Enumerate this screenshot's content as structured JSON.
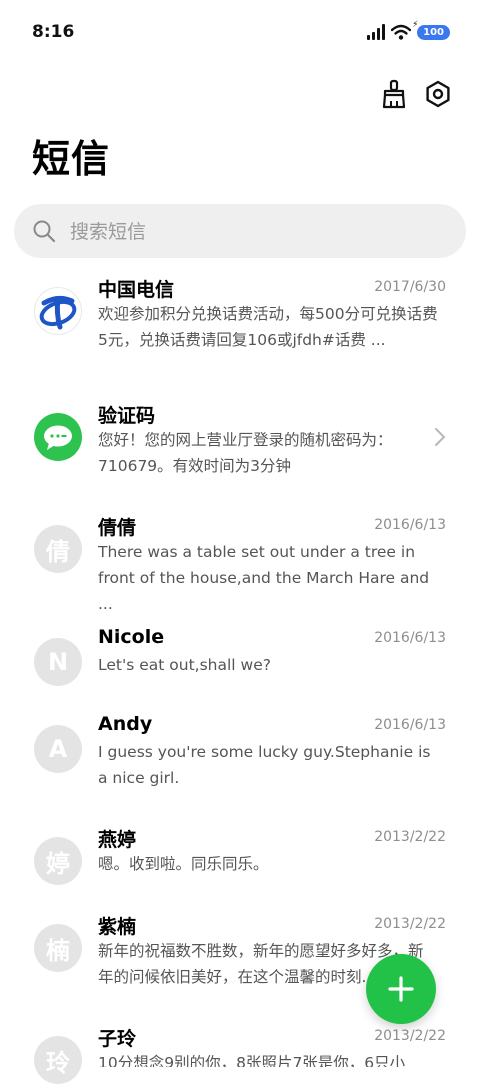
{
  "status_bar": {
    "time": "8:16",
    "battery": "100",
    "battery_charging_glyph": "⚡"
  },
  "toolbar": {
    "clean_icon": "broom-icon",
    "settings_icon": "settings-hexagon-icon"
  },
  "page": {
    "title": "短信"
  },
  "search": {
    "placeholder": "搜索短信",
    "value": ""
  },
  "messages": [
    {
      "avatar": "",
      "avatar_icon": "china-telecom-logo",
      "name": "中国电信",
      "date": "2017/6/30",
      "preview": "欢迎参加积分兑换话费活动，每500分可兑换话费5元，兑换话费请回复106或jfdh#话费 ..."
    },
    {
      "avatar": "",
      "avatar_icon": "chat-bubble-icon",
      "name": "验证码",
      "date": "",
      "preview": "您好！您的网上营业厅登录的随机密码为：710679。有效时间为3分钟"
    },
    {
      "avatar": "倩",
      "name": "倩倩",
      "date": "2016/6/13",
      "preview": "There was a table set out under a tree in front of the house,and the March Hare and ..."
    },
    {
      "avatar": "N",
      "name": "Nicole",
      "date": "2016/6/13",
      "preview": "Let's eat out,shall we?"
    },
    {
      "avatar": "A",
      "name": "Andy",
      "date": "2016/6/13",
      "preview": "I guess you're some lucky guy.Stephanie is a nice girl."
    },
    {
      "avatar": "婷",
      "name": "燕婷",
      "date": "2013/2/22",
      "preview": "嗯。收到啦。同乐同乐。"
    },
    {
      "avatar": "楠",
      "name": "紫楠",
      "date": "2013/2/22",
      "preview": "新年的祝福数不胜数，新年的愿望好多好多，新年的问候依旧美好，在这个温馨的时刻..."
    },
    {
      "avatar": "玲",
      "name": "子玲",
      "date": "2013/2/22",
      "preview": "10分想念9别的你，8张照片7张是你，6只小"
    }
  ],
  "fab": {
    "label": "+",
    "icon": "plus-icon"
  },
  "colors": {
    "accent_green": "#22c248",
    "telecom_blue": "#1f56c7",
    "battery_blue": "#3a78f2"
  }
}
